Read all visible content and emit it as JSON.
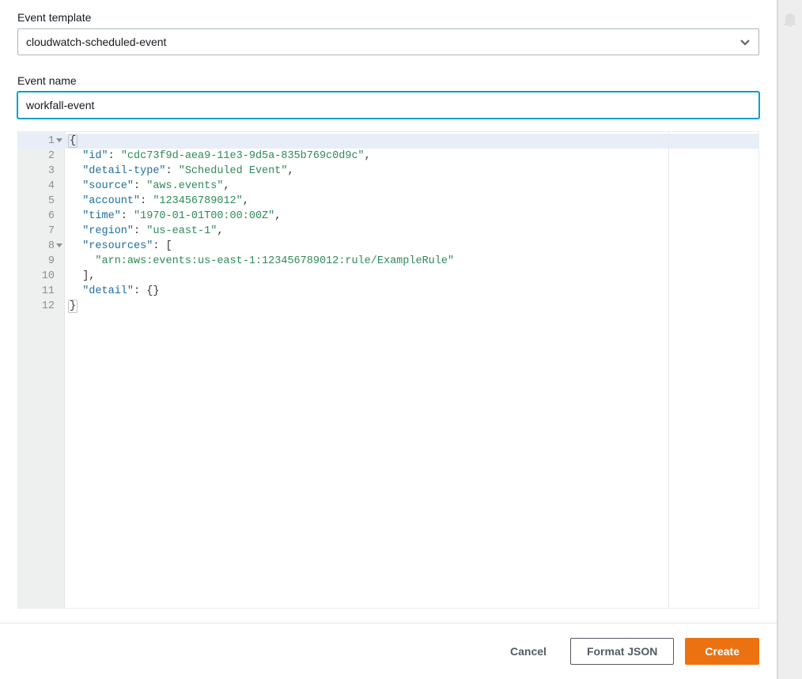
{
  "form": {
    "template_label": "Event template",
    "template_value": "cloudwatch-scheduled-event",
    "name_label": "Event name",
    "name_value": "workfall-event"
  },
  "editor": {
    "lines": [
      {
        "n": "1",
        "fold": true,
        "tokens": [
          {
            "t": "{",
            "c": "punc",
            "hl": true
          }
        ]
      },
      {
        "n": "2",
        "fold": false,
        "tokens": [
          {
            "t": "  ",
            "c": "plain"
          },
          {
            "t": "\"id\"",
            "c": "key"
          },
          {
            "t": ": ",
            "c": "punc"
          },
          {
            "t": "\"cdc73f9d-aea9-11e3-9d5a-835b769c0d9c\"",
            "c": "str"
          },
          {
            "t": ",",
            "c": "punc"
          }
        ]
      },
      {
        "n": "3",
        "fold": false,
        "tokens": [
          {
            "t": "  ",
            "c": "plain"
          },
          {
            "t": "\"detail-type\"",
            "c": "key"
          },
          {
            "t": ": ",
            "c": "punc"
          },
          {
            "t": "\"Scheduled Event\"",
            "c": "str"
          },
          {
            "t": ",",
            "c": "punc"
          }
        ]
      },
      {
        "n": "4",
        "fold": false,
        "tokens": [
          {
            "t": "  ",
            "c": "plain"
          },
          {
            "t": "\"source\"",
            "c": "key"
          },
          {
            "t": ": ",
            "c": "punc"
          },
          {
            "t": "\"aws.events\"",
            "c": "str"
          },
          {
            "t": ",",
            "c": "punc"
          }
        ]
      },
      {
        "n": "5",
        "fold": false,
        "tokens": [
          {
            "t": "  ",
            "c": "plain"
          },
          {
            "t": "\"account\"",
            "c": "key"
          },
          {
            "t": ": ",
            "c": "punc"
          },
          {
            "t": "\"123456789012\"",
            "c": "str"
          },
          {
            "t": ",",
            "c": "punc"
          }
        ]
      },
      {
        "n": "6",
        "fold": false,
        "tokens": [
          {
            "t": "  ",
            "c": "plain"
          },
          {
            "t": "\"time\"",
            "c": "key"
          },
          {
            "t": ": ",
            "c": "punc"
          },
          {
            "t": "\"1970-01-01T00:00:00Z\"",
            "c": "str"
          },
          {
            "t": ",",
            "c": "punc"
          }
        ]
      },
      {
        "n": "7",
        "fold": false,
        "tokens": [
          {
            "t": "  ",
            "c": "plain"
          },
          {
            "t": "\"region\"",
            "c": "key"
          },
          {
            "t": ": ",
            "c": "punc"
          },
          {
            "t": "\"us-east-1\"",
            "c": "str"
          },
          {
            "t": ",",
            "c": "punc"
          }
        ]
      },
      {
        "n": "8",
        "fold": true,
        "tokens": [
          {
            "t": "  ",
            "c": "plain"
          },
          {
            "t": "\"resources\"",
            "c": "key"
          },
          {
            "t": ": [",
            "c": "punc"
          }
        ]
      },
      {
        "n": "9",
        "fold": false,
        "tokens": [
          {
            "t": "    ",
            "c": "plain"
          },
          {
            "t": "\"arn:aws:events:us-east-1:123456789012:rule/ExampleRule\"",
            "c": "str"
          }
        ]
      },
      {
        "n": "10",
        "fold": false,
        "tokens": [
          {
            "t": "  ],",
            "c": "punc"
          }
        ]
      },
      {
        "n": "11",
        "fold": false,
        "tokens": [
          {
            "t": "  ",
            "c": "plain"
          },
          {
            "t": "\"detail\"",
            "c": "key"
          },
          {
            "t": ": {}",
            "c": "punc"
          }
        ]
      },
      {
        "n": "12",
        "fold": false,
        "tokens": [
          {
            "t": "}",
            "c": "punc",
            "hl": true
          }
        ]
      }
    ]
  },
  "footer": {
    "cancel": "Cancel",
    "format": "Format JSON",
    "create": "Create"
  }
}
